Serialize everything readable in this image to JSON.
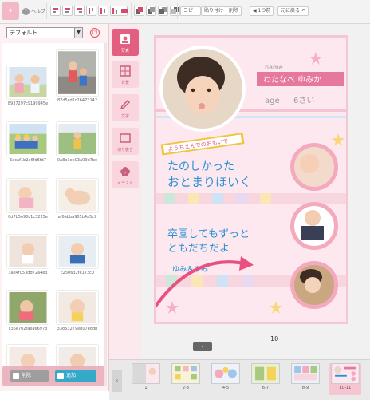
{
  "toolbar": {
    "help_label": "ヘルプ",
    "copy_label": "コピー",
    "paste_label": "貼り付け",
    "delete_label": "削除",
    "prev_page_label": "1つ前",
    "back_label": "元に戻る"
  },
  "left": {
    "dropdown_value": "デフォルト",
    "delete_button": "削除",
    "add_button": "追加",
    "thumbnails": [
      {
        "name": "8937297c9199945e"
      },
      {
        "name": "87d5cd1c26473142"
      },
      {
        "name": "6acaf1b2a6fd6fd7"
      },
      {
        "name": "0a8e3ee03a09d7be"
      },
      {
        "name": "0d7b5e90c1c3225e"
      },
      {
        "name": "af6abba905b4a5c9"
      },
      {
        "name": "3ae4f053dd72a4e3"
      },
      {
        "name": "c250632fe173c0"
      },
      {
        "name": "c36e702faea6697b"
      },
      {
        "name": "33853279eb07e6db"
      },
      {
        "name": ""
      },
      {
        "name": ""
      }
    ]
  },
  "tools": [
    {
      "label": "写真"
    },
    {
      "label": "背景"
    },
    {
      "label": "文字"
    },
    {
      "label": "切り抜き"
    },
    {
      "label": "イラスト"
    }
  ],
  "page": {
    "name_tag": "name",
    "name_value": "わたなべ ゆみか",
    "age_tag": "age",
    "age_value": "6さい",
    "ribbon": "ようちえんでのおもいで",
    "line1": "たのしかった",
    "line2": "おとまりほいく",
    "line3": "卒園してもずっと",
    "line4": "ともだちだよ",
    "signature": "ゆみ＆まみ",
    "page_number": "10"
  },
  "strip": {
    "pages": [
      {
        "label": "1"
      },
      {
        "label": "2-3"
      },
      {
        "label": "4-5"
      },
      {
        "label": "6-7"
      },
      {
        "label": "8-9"
      },
      {
        "label": "10-11"
      }
    ]
  },
  "colors": {
    "accent": "#e35f80",
    "page_bg": "#fde8ef",
    "title_blue": "#2a8fd6",
    "name_band": "#e5789b",
    "ribbon": "#f2c541"
  }
}
